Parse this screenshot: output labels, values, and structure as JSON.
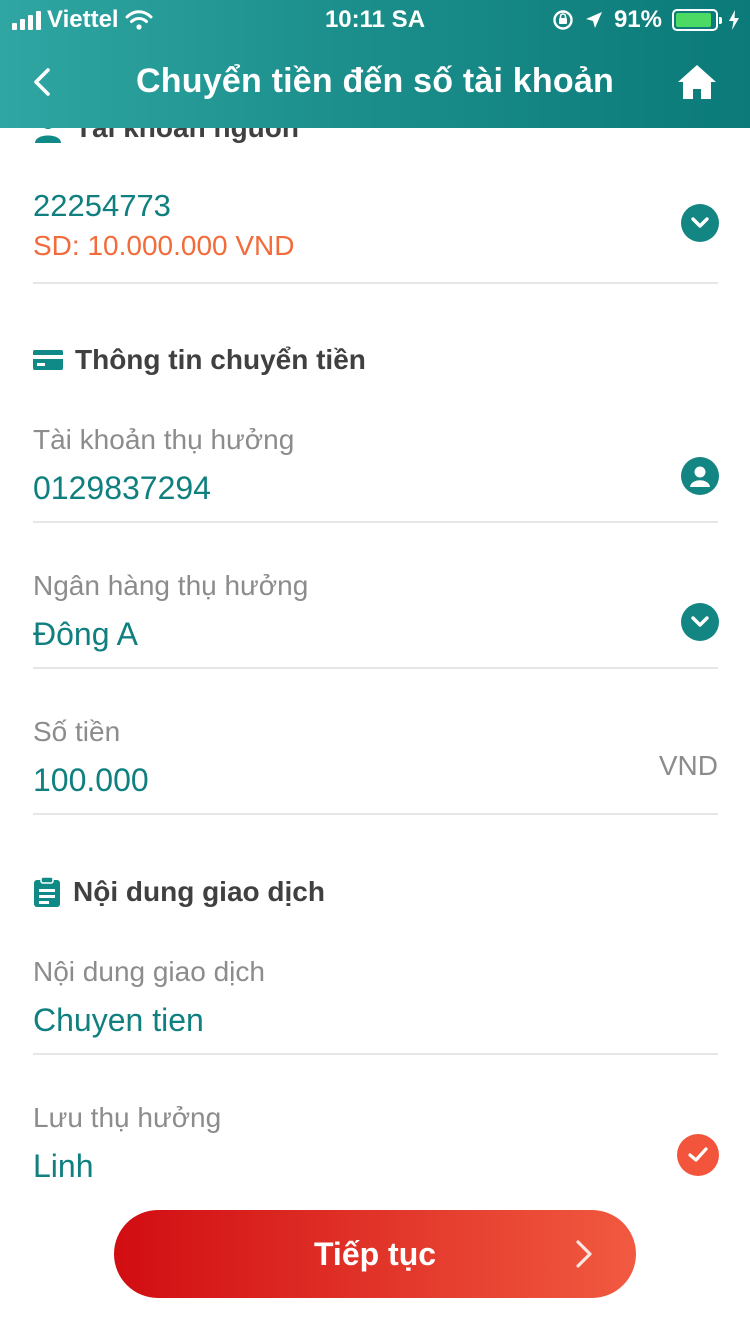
{
  "status_bar": {
    "carrier": "Viettel",
    "time": "10:11 SA",
    "battery_percent": "91%",
    "battery_level": 0.91
  },
  "nav": {
    "title": "Chuyển tiền đến số tài khoản"
  },
  "source_account": {
    "section_title": "Tài khoản nguồn",
    "account_number": "22254773",
    "balance": "SD: 10.000.000  VND"
  },
  "transfer_info": {
    "section_title": "Thông tin chuyển tiền",
    "beneficiary_account_label": "Tài khoản thụ hưởng",
    "beneficiary_account_value": "0129837294",
    "beneficiary_bank_label": "Ngân hàng thụ hưởng",
    "beneficiary_bank_value": "Đông A",
    "amount_label": "Số tiền",
    "amount_value": "100.000",
    "amount_currency": "VND"
  },
  "transaction_content": {
    "section_title": "Nội dung giao dịch",
    "content_label": "Nội dung giao dịch",
    "content_value": "Chuyen tien",
    "save_beneficiary_label": "Lưu thụ hưởng",
    "save_beneficiary_value": "Linh",
    "save_beneficiary_checked": true
  },
  "actions": {
    "continue_label": "Tiếp tục"
  },
  "colors": {
    "header_start": "#2fa6a3",
    "header_end": "#0b7a78",
    "accent_teal": "#0f7f7f",
    "balance_orange": "#f26b3a",
    "button_start": "#d10d12",
    "button_end": "#f15a40"
  },
  "icons": [
    "back-icon",
    "home-icon",
    "user-icon",
    "chevron-down-icon",
    "card-icon",
    "user-circle-icon",
    "clipboard-icon",
    "check-icon",
    "chevron-right-icon"
  ]
}
